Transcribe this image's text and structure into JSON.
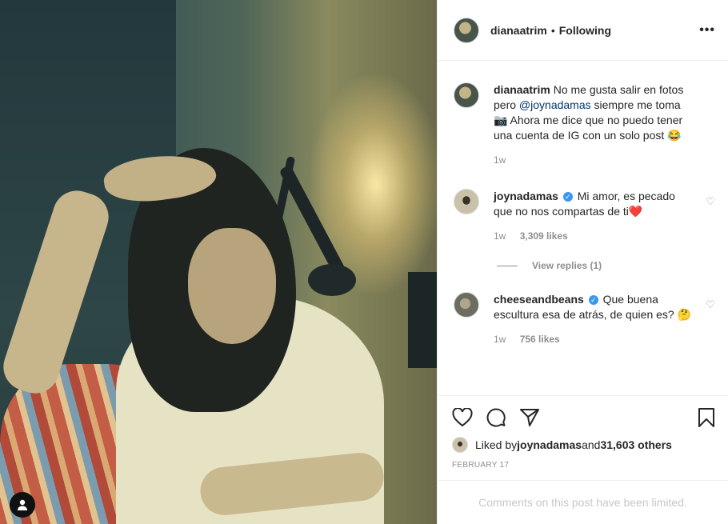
{
  "post": {
    "username": "dianaatrim",
    "separator": "•",
    "follow_status": "Following",
    "more_label": "•••"
  },
  "caption": {
    "username": "dianaatrim",
    "text_before": "No me gusta salir en fotos pero ",
    "mention": "@joynadamas",
    "text_after": " siempre me toma 📷 Ahora me dice que no puedo tener una cuenta de IG con un solo post 😂",
    "time": "1w"
  },
  "comments": [
    {
      "username": "joynadamas",
      "verified": true,
      "text": "Mi amor, es pecado que no nos compartas de ti❤️",
      "time": "1w",
      "likes": "3,309 likes",
      "replies": "View replies (1)"
    },
    {
      "username": "cheeseandbeans",
      "verified": true,
      "text": "Que buena escultura esa de atrás, de quien es? 🤔",
      "time": "1w",
      "likes": "756 likes"
    }
  ],
  "likes": {
    "prefix": "Liked by ",
    "user": "joynadamas",
    "middle": " and ",
    "others": "31,603 others"
  },
  "date": "FEBRUARY 17",
  "comments_limited": "Comments on this post have been limited."
}
